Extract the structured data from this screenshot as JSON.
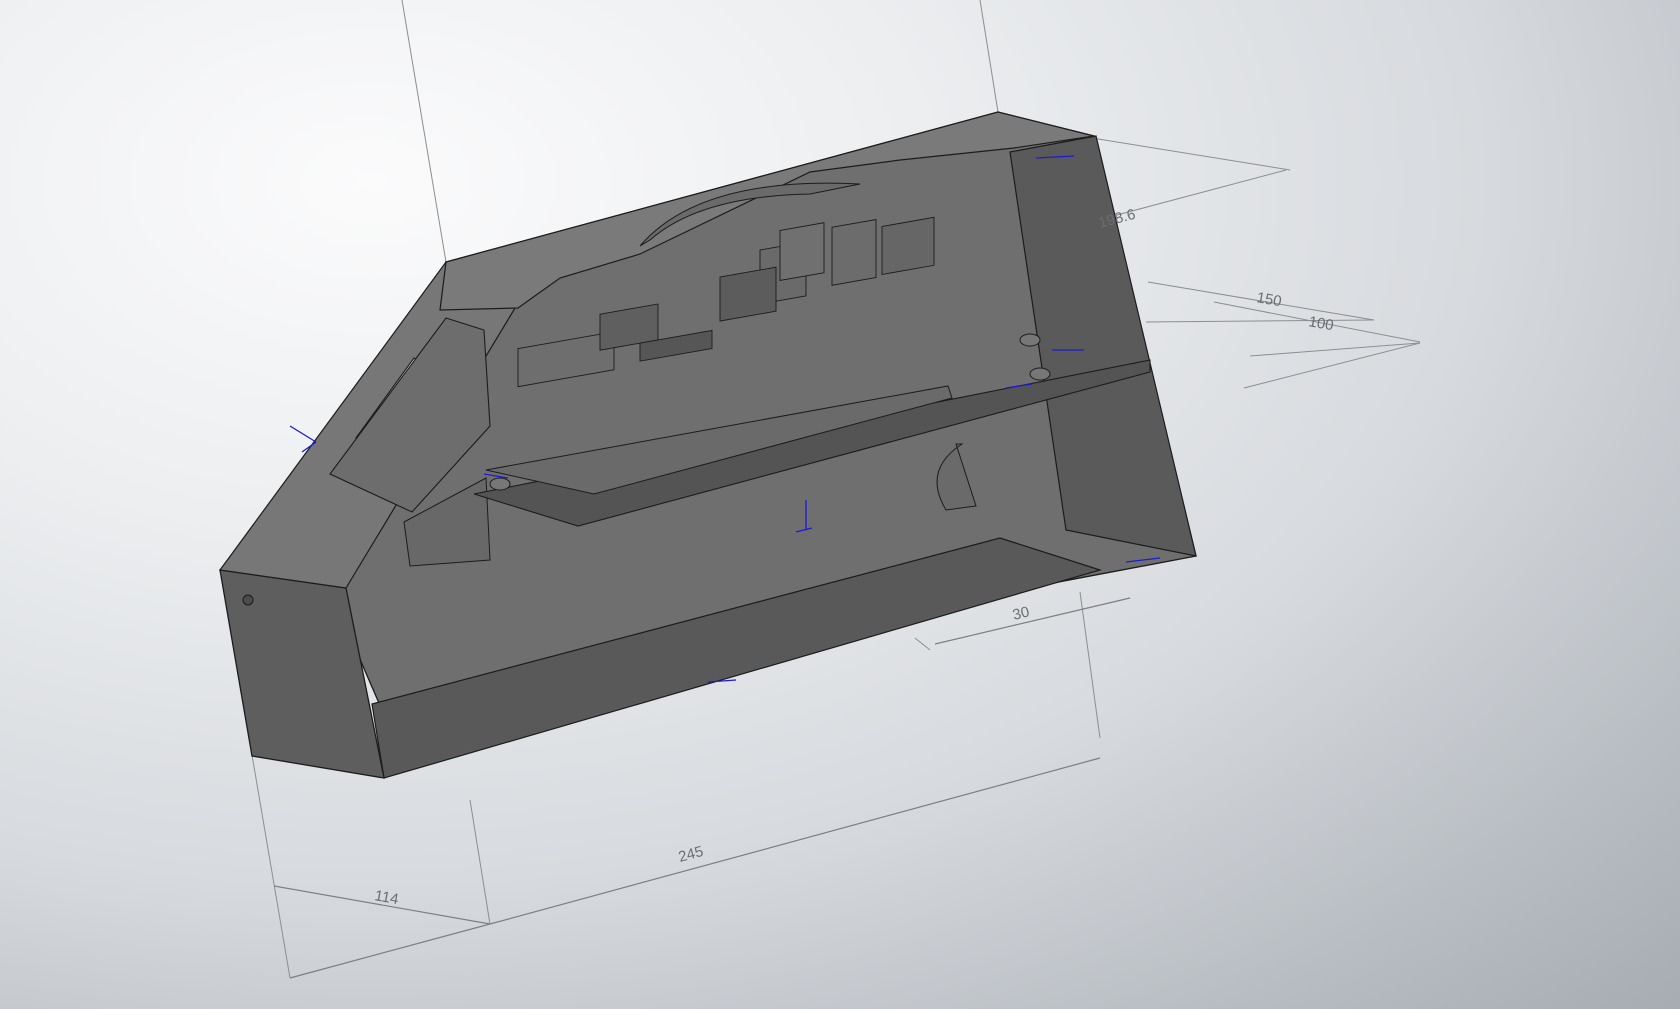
{
  "dimensions": {
    "d114": "114",
    "d245": "245",
    "d30": "30",
    "d_top": "198.6",
    "d_right_a": "150",
    "d_right_b": "100"
  },
  "colors": {
    "background_light": "#f4f5f6",
    "background_dark": "#a7acb3",
    "box_dark": "#5e5e5e",
    "box_mid": "#6f6f6f",
    "box_light": "#7a7a7a",
    "edge": "#1c1c1c",
    "dimension_line": "#7c7f84",
    "triad_blue": "#1b1bd6"
  },
  "icons": {
    "triad": "coordinate-triad-icon",
    "mate": "mate-arrow-icon"
  }
}
